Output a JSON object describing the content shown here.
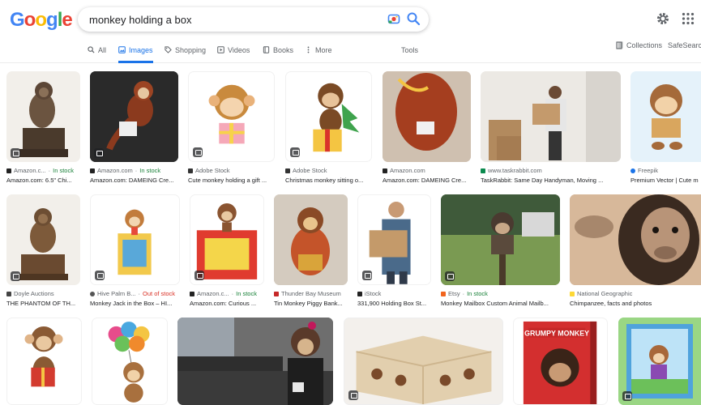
{
  "header": {
    "logo": "Google",
    "search_value": "monkey holding a box",
    "logo_colors": [
      "#4285f4",
      "#ea4335",
      "#fbbc05",
      "#4285f4",
      "#34a853",
      "#ea4335"
    ]
  },
  "tabs": [
    {
      "label": "All",
      "icon": "search-icon"
    },
    {
      "label": "Images",
      "icon": "image-icon",
      "active": true
    },
    {
      "label": "Shopping",
      "icon": "tag-icon"
    },
    {
      "label": "Videos",
      "icon": "play-icon"
    },
    {
      "label": "Books",
      "icon": "book-icon"
    },
    {
      "label": "More",
      "icon": "more-icon"
    }
  ],
  "tools_label": "Tools",
  "collections_label": "Collections",
  "safesearch_label": "SafeSearch",
  "results": [
    {
      "source": "Amazon.c...",
      "stock": "In stock",
      "title": "Amazon.com: 6.5\" Chi..."
    },
    {
      "source": "Amazon.com",
      "stock": "In stock",
      "title": "Amazon.com: DAMEING Cre..."
    },
    {
      "source": "Adobe Stock",
      "stock": "",
      "title": "Cute monkey holding a gift ..."
    },
    {
      "source": "Adobe Stock",
      "stock": "",
      "title": "Christmas monkey sitting o..."
    },
    {
      "source": "Amazon.com",
      "stock": "",
      "title": "Amazon.com: DAMEING Cre..."
    },
    {
      "source": "www.taskrabbit.com",
      "stock": "",
      "title": "TaskRabbit: Same Day Handyman, Moving ..."
    },
    {
      "source": "Freepik",
      "stock": "",
      "title": "Premium Vector | Cute m"
    },
    {
      "source": "Doyle Auctions",
      "stock": "",
      "title": "THE PHANTOM OF TH..."
    },
    {
      "source": "Hive Palm B...",
      "stock": "Out of stock",
      "title": "Monkey Jack in the Box – HI..."
    },
    {
      "source": "Amazon.c...",
      "stock": "In stock",
      "title": "Amazon.com: Curious ..."
    },
    {
      "source": "Thunder Bay Museum",
      "stock": "",
      "title": "Tin Monkey Piggy Bank..."
    },
    {
      "source": "iStock",
      "stock": "",
      "title": "331,900 Holding Box St..."
    },
    {
      "source": "Etsy",
      "stock": "In stock",
      "title": "Monkey Mailbox Custom Animal Mailb..."
    },
    {
      "source": "National Geographic",
      "stock": "",
      "title": "Chimpanzee, facts and photos"
    },
    {
      "source": "",
      "stock": "",
      "title": ""
    },
    {
      "source": "",
      "stock": "",
      "title": ""
    },
    {
      "source": "",
      "stock": "",
      "title": ""
    },
    {
      "source": "",
      "stock": "",
      "title": ""
    },
    {
      "source": "",
      "stock": "",
      "title": ""
    },
    {
      "source": "",
      "stock": "",
      "title": ""
    }
  ]
}
